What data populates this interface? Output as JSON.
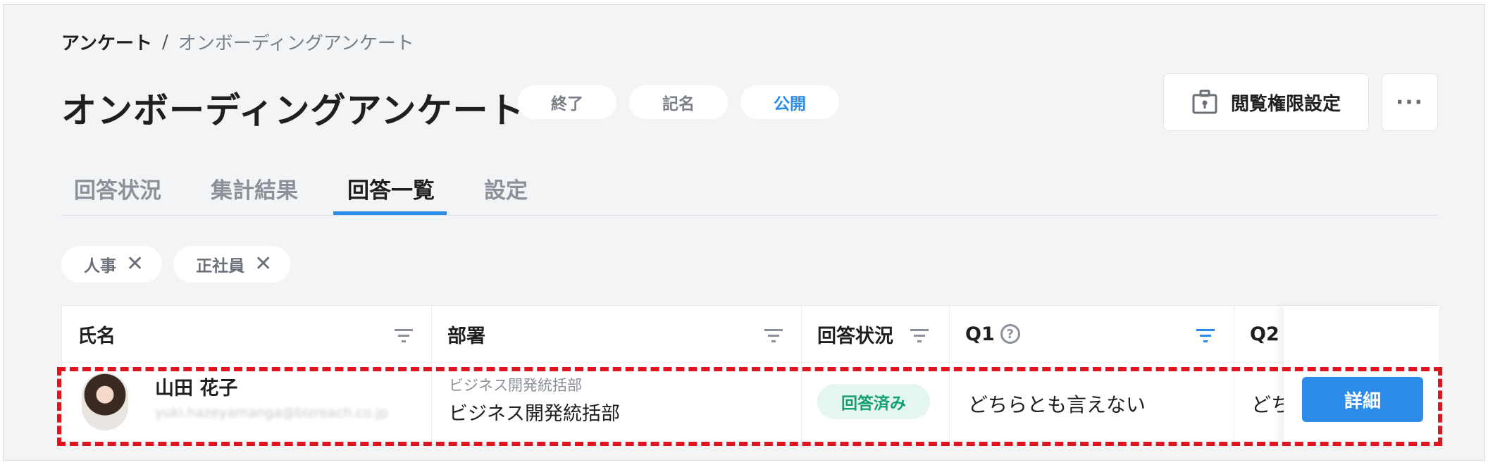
{
  "breadcrumb": {
    "root": "アンケート",
    "separator": "/",
    "current": "オンボーディングアンケート"
  },
  "title": "オンボーディングアンケート",
  "badges": [
    "終了",
    "記名",
    "公開"
  ],
  "toolbar": {
    "permission_label": "閲覧権限設定",
    "more_label": "···"
  },
  "tabs": [
    {
      "label": "回答状況",
      "active": false
    },
    {
      "label": "集計結果",
      "active": false
    },
    {
      "label": "回答一覧",
      "active": true
    },
    {
      "label": "設定",
      "active": false
    }
  ],
  "filters": [
    {
      "label": "人事",
      "remove": "✕"
    },
    {
      "label": "正社員",
      "remove": "✕"
    }
  ],
  "table": {
    "columns": [
      {
        "label": "氏名",
        "filter_active": false
      },
      {
        "label": "部署",
        "filter_active": false
      },
      {
        "label": "回答状況",
        "filter_active": false
      },
      {
        "label": "Q1",
        "filter_active": true,
        "help": "?"
      },
      {
        "label": "Q2"
      }
    ],
    "rows": [
      {
        "name": "山田 花子",
        "email": "yuki.hazeyamanga@bizreach.co.jp",
        "department_parent": "ビジネス開発統括部",
        "department": "ビジネス開発統括部",
        "status": "回答済み",
        "q1": "どちらとも言えない",
        "q2": "どち",
        "action": "詳細"
      }
    ]
  },
  "colors": {
    "accent": "#2b8be8",
    "success": "#13a06f",
    "highlight": "#e0141e"
  }
}
